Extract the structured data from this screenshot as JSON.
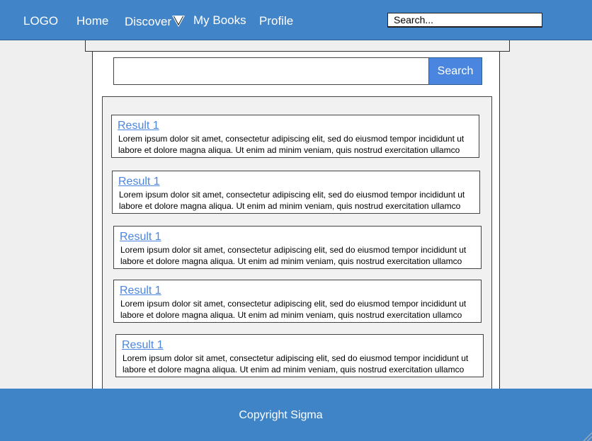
{
  "nav": {
    "logo": "LOGO",
    "home": "Home",
    "discover": "Discover",
    "my_books": "My Books",
    "profile": "Profile",
    "search_placeholder": "Search..."
  },
  "search": {
    "button_label": "Search",
    "value": ""
  },
  "results": [
    {
      "title": "Result 1",
      "text": "Lorem ipsum dolor sit amet, consectetur adipiscing elit, sed do eiusmod tempor incididunt ut labore et dolore magna aliqua. Ut enim ad minim veniam, quis nostrud exercitation ullamco"
    },
    {
      "title": "Result 1",
      "text": "Lorem ipsum dolor sit amet, consectetur adipiscing elit, sed do eiusmod tempor incididunt ut labore et dolore magna aliqua. Ut enim ad minim veniam, quis nostrud exercitation ullamco"
    },
    {
      "title": "Result 1",
      "text": "Lorem ipsum dolor sit amet, consectetur adipiscing elit, sed do eiusmod tempor incididunt ut labore et dolore magna aliqua. Ut enim ad minim veniam, quis nostrud exercitation ullamco"
    },
    {
      "title": "Result 1",
      "text": "Lorem ipsum dolor sit amet, consectetur adipiscing elit, sed do eiusmod tempor incididunt ut labore et dolore magna aliqua. Ut enim ad minim veniam, quis nostrud exercitation ullamco"
    },
    {
      "title": "Result 1",
      "text": "Lorem ipsum dolor sit amet, consectetur adipiscing elit, sed do eiusmod tempor incididunt ut labore et dolore magna aliqua. Ut enim ad minim veniam, quis nostrud exercitation ullamco"
    }
  ],
  "footer": {
    "copyright": "Copyright Sigma"
  },
  "colors": {
    "header": "#4184c8",
    "footer": "#3f84c6",
    "accent": "#4a86e0"
  }
}
